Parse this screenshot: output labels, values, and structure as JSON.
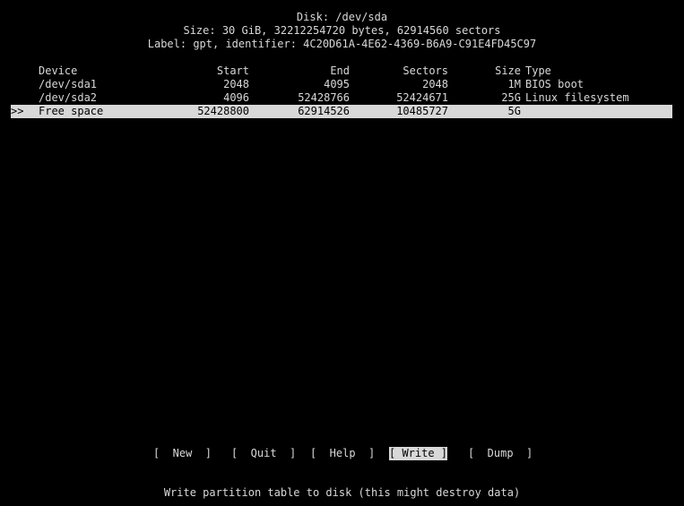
{
  "header": {
    "disk": "Disk: /dev/sda",
    "size": "Size: 30 GiB, 32212254720 bytes, 62914560 sectors",
    "label": "Label: gpt, identifier: 4C20D61A-4E62-4369-B6A9-C91E4FD45C97"
  },
  "table": {
    "columns": {
      "device": "Device",
      "start": "Start",
      "end": "End",
      "sectors": "Sectors",
      "size": "Size",
      "type": "Type"
    },
    "rows": [
      {
        "marker": "",
        "device": "/dev/sda1",
        "start": "2048",
        "end": "4095",
        "sectors": "2048",
        "size": "1M",
        "type": "BIOS boot"
      },
      {
        "marker": "",
        "device": "/dev/sda2",
        "start": "4096",
        "end": "52428766",
        "sectors": "52424671",
        "size": "25G",
        "type": "Linux filesystem"
      },
      {
        "marker": ">>",
        "device": "Free space",
        "start": "52428800",
        "end": "62914526",
        "sectors": "10485727",
        "size": "5G",
        "type": ""
      }
    ]
  },
  "menu": {
    "new": "[  New  ]",
    "quit": "[  Quit  ]",
    "help": "[  Help  ]",
    "write": "[ Write ]",
    "dump": "[  Dump  ]"
  },
  "hint": "Write partition table to disk (this might destroy data)",
  "colors": {
    "background": "#000000",
    "foreground": "#d8d8d8",
    "highlight": "#d8d8d8"
  }
}
